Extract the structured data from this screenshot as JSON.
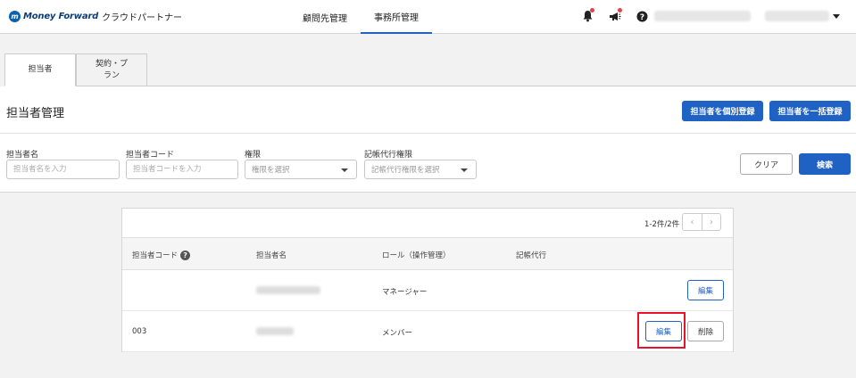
{
  "header": {
    "logo_text": "Money Forward",
    "logo_sub": "クラウドパートナー",
    "nav": [
      {
        "label": "顧問先管理"
      },
      {
        "label": "事務所管理"
      }
    ],
    "icons": [
      "bell-icon",
      "megaphone-icon",
      "help-icon",
      "chevron-down-icon"
    ]
  },
  "tabs": [
    {
      "label": "担当者"
    },
    {
      "label": "契約・プラン"
    }
  ],
  "page": {
    "title": "担当者管理",
    "register_single": "担当者を個別登録",
    "register_bulk": "担当者を一括登録"
  },
  "filters": {
    "name": {
      "label": "担当者名",
      "placeholder": "担当者名を入力"
    },
    "code": {
      "label": "担当者コード",
      "placeholder": "担当者コードを入力"
    },
    "permission": {
      "label": "権限",
      "value": "権限を選択"
    },
    "bookkeeping": {
      "label": "記帳代行権限",
      "value": "記帳代行権限を選択"
    },
    "clear": "クリア",
    "search": "検索"
  },
  "table": {
    "pager": "1-2件/2件",
    "headers": {
      "code": "担当者コード",
      "name": "担当者名",
      "role": "ロール（操作管理）",
      "bookkeeping": "記帳代行"
    },
    "rows": [
      {
        "code": "",
        "role": "マネージャー",
        "edit": "編集"
      },
      {
        "code": "003",
        "role": "メンバー",
        "edit": "編集",
        "delete": "削除"
      }
    ]
  },
  "colors": {
    "primary": "#2062c4",
    "highlight": "#e8132a",
    "badge": "#e8404a"
  }
}
